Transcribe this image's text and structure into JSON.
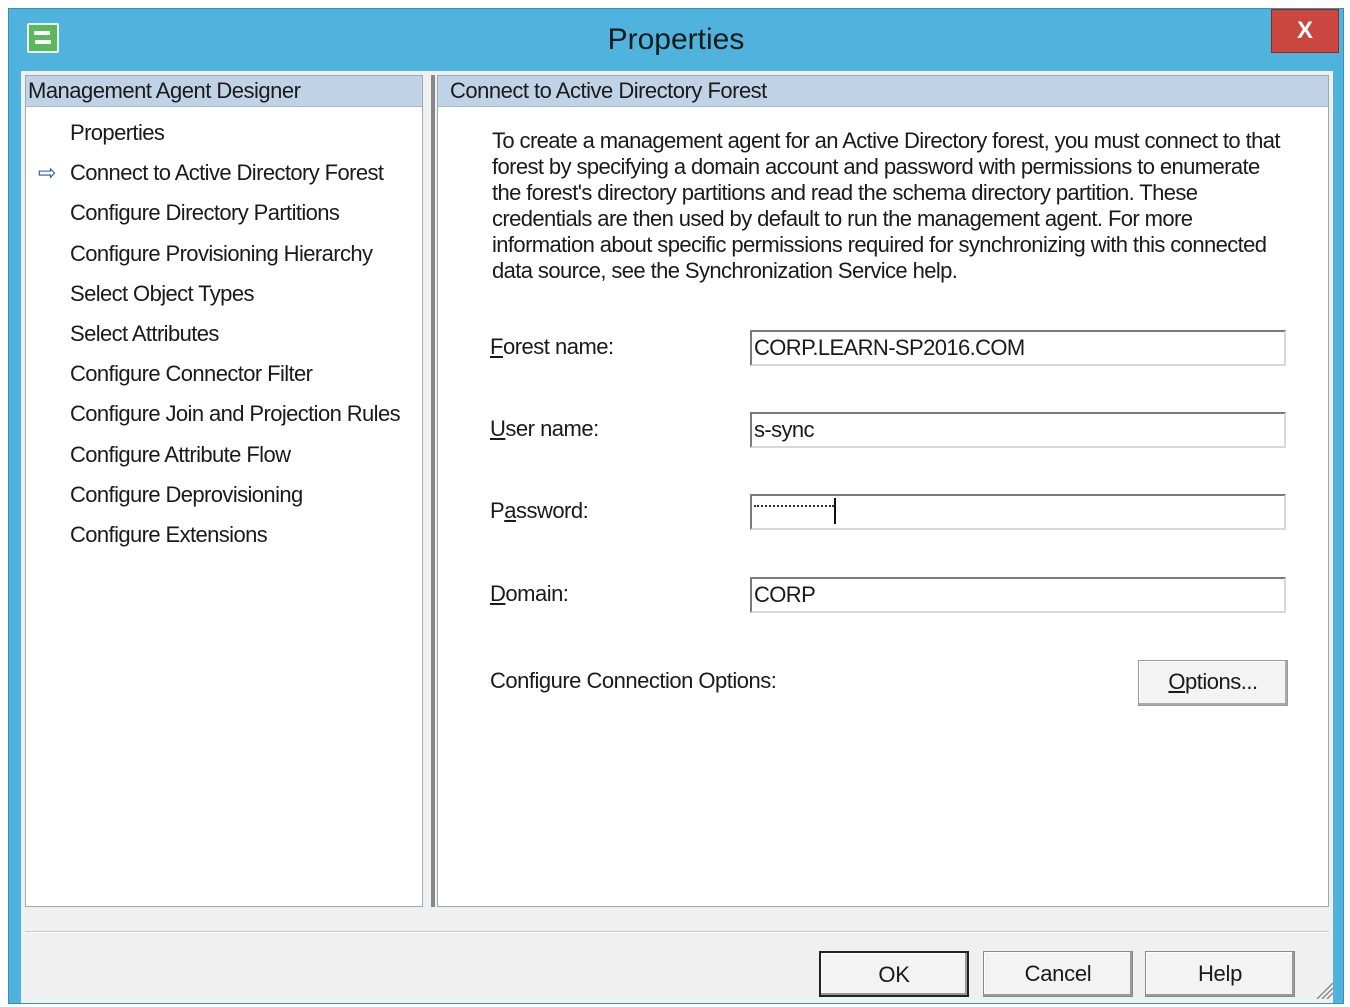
{
  "window": {
    "title": "Properties",
    "close_label": "X"
  },
  "sidebar": {
    "header": "Management Agent Designer",
    "items": [
      {
        "label": "Properties",
        "active": false
      },
      {
        "label": "Connect to Active Directory Forest",
        "active": true
      },
      {
        "label": "Configure Directory Partitions",
        "active": false
      },
      {
        "label": "Configure Provisioning Hierarchy",
        "active": false
      },
      {
        "label": "Select Object Types",
        "active": false
      },
      {
        "label": "Select Attributes",
        "active": false
      },
      {
        "label": "Configure Connector Filter",
        "active": false
      },
      {
        "label": "Configure Join and Projection Rules",
        "active": false
      },
      {
        "label": "Configure Attribute Flow",
        "active": false
      },
      {
        "label": "Configure Deprovisioning",
        "active": false
      },
      {
        "label": "Configure Extensions",
        "active": false
      }
    ],
    "active_marker": "⇨"
  },
  "main": {
    "header": "Connect to Active Directory Forest",
    "description": "To create a management agent for an Active Directory forest, you must connect to that forest by specifying a domain account and password with permissions to enumerate the forest's directory partitions and read the schema directory partition. These credentials are then used by default to run the management agent. For more information about specific permissions required for synchronizing with this connected data source, see the Synchronization Service help.",
    "fields": {
      "forest": {
        "label_access": "F",
        "label_rest": "orest name:",
        "value": "CORP.LEARN-SP2016.COM"
      },
      "user": {
        "label_access": "U",
        "label_rest": "ser name:",
        "value": "s-sync"
      },
      "password": {
        "label_pre": "P",
        "label_access": "a",
        "label_rest": "ssword:",
        "masked": true
      },
      "domain": {
        "label_access": "D",
        "label_rest": "omain:",
        "value": "CORP"
      }
    },
    "connection_options_label": "Configure Connection Options:",
    "options_button": {
      "access": "O",
      "rest": "ptions..."
    }
  },
  "footer": {
    "ok_label": "OK",
    "cancel_label": "Cancel",
    "help_label": "Help"
  },
  "colors": {
    "titlebar": "#4fb3dd",
    "close": "#c9473f",
    "pane_header": "#c0d3e6",
    "arrow": "#2255aa"
  }
}
